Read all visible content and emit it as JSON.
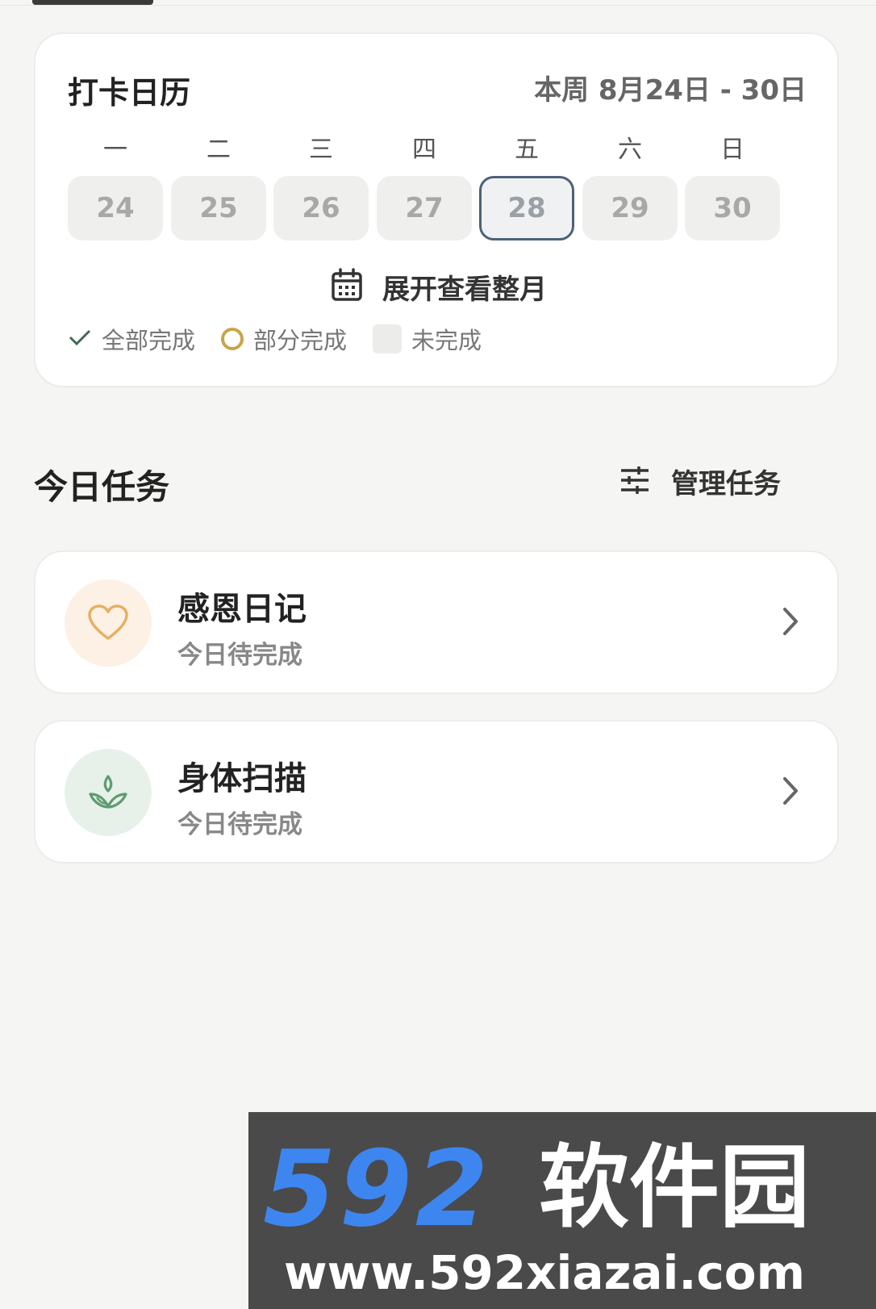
{
  "calendar": {
    "title": "打卡日历",
    "range_label": "本周 8月24日 - 30日",
    "weekdays": [
      "一",
      "二",
      "三",
      "四",
      "五",
      "六",
      "日"
    ],
    "days": [
      "24",
      "25",
      "26",
      "27",
      "28",
      "29",
      "30"
    ],
    "today": "28",
    "expand_label": "展开查看整月",
    "legend": {
      "all_done": "全部完成",
      "partial": "部分完成",
      "not_done": "未完成"
    }
  },
  "tasks_section": {
    "title": "今日任务",
    "manage_label": "管理任务",
    "items": [
      {
        "name": "感恩日记",
        "status": "今日待完成",
        "icon": "heart-icon",
        "icon_bg": "#fdf0e4",
        "icon_color": "#e3b162"
      },
      {
        "name": "身体扫描",
        "status": "今日待完成",
        "icon": "sprout-icon",
        "icon_bg": "#e7f1ea",
        "icon_color": "#5e9c70"
      }
    ]
  },
  "watermark": {
    "brand_number": "592",
    "brand_name": "软件园",
    "url": "www.592xiazai.com"
  },
  "colors": {
    "accent_check": "#3f6b52",
    "accent_ring": "#c9a44a",
    "today_border": "#4e6177",
    "background": "#f5f5f3"
  }
}
